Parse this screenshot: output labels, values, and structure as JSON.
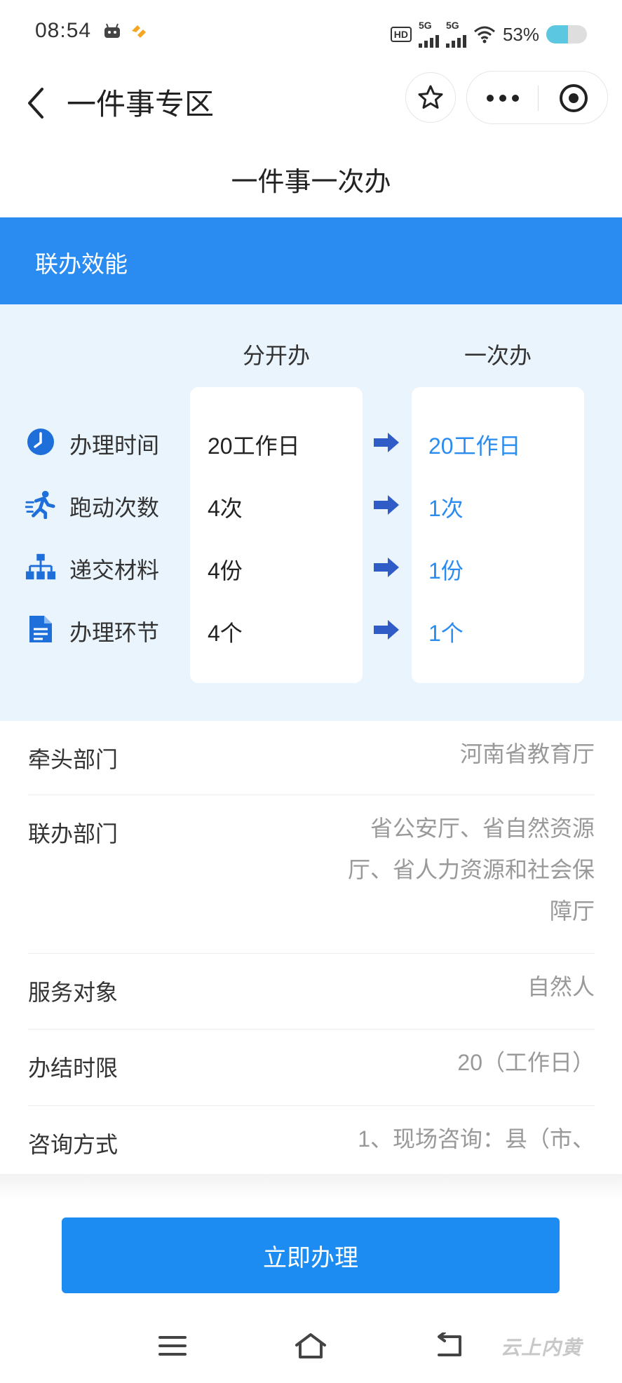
{
  "status_bar": {
    "time": "08:54",
    "battery": "53%",
    "battery_level": 0.53,
    "hd_label": "HD",
    "network_labels": [
      "5G",
      "5G"
    ]
  },
  "nav": {
    "title": "一件事专区"
  },
  "page_title": "一件事一次办",
  "section_header": "联办效能",
  "compare": {
    "col_separate": "分开办",
    "col_once": "一次办",
    "rows": [
      {
        "label": "办理时间",
        "icon": "clock-icon",
        "separate": "20工作日",
        "once": "20工作日"
      },
      {
        "label": "跑动次数",
        "icon": "running-icon",
        "separate": "4次",
        "once": "1次"
      },
      {
        "label": "递交材料",
        "icon": "org-chart-icon",
        "separate": "4份",
        "once": "1份"
      },
      {
        "label": "办理环节",
        "icon": "document-icon",
        "separate": "4个",
        "once": "1个"
      }
    ]
  },
  "info": {
    "rows": [
      {
        "label": "牵头部门",
        "value": "河南省教育厅"
      },
      {
        "label": "联办部门",
        "value_lines": [
          "省公安厅、省自然资源",
          "厅、省人力资源和社会保",
          "障厅"
        ]
      },
      {
        "label": "服务对象",
        "value": "自然人"
      },
      {
        "label": "办结时限",
        "value": "20（工作日）"
      },
      {
        "label": "咨询方式",
        "value": "1、现场咨询：县（市、"
      }
    ]
  },
  "action_button": "立即办理",
  "watermark": "云上内黄",
  "colors": {
    "primary": "#2a8cf0",
    "panel_bg": "#eaf4fc",
    "arrow": "#2f5cc7",
    "muted_text": "#999999"
  }
}
